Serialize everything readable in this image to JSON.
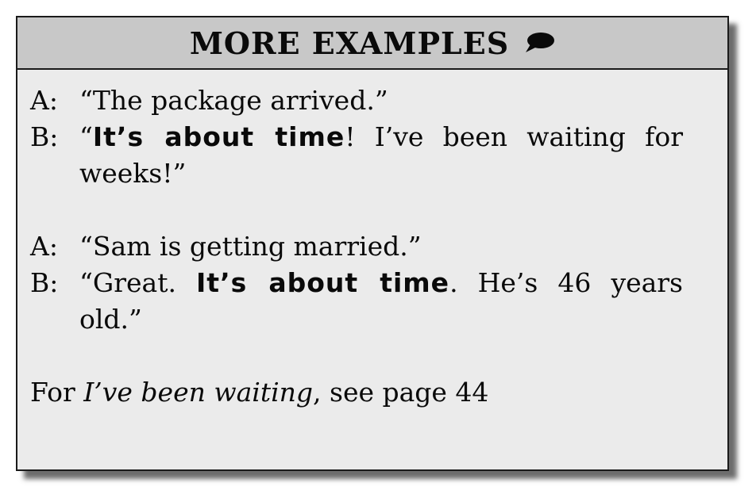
{
  "header": {
    "title": "MORE EXAMPLES"
  },
  "examples": [
    {
      "a_speaker": "A:",
      "a_text": "“The package arrived.”",
      "b_speaker": "B:",
      "b_pre": "“",
      "b_bold": "It’s about time",
      "b_post": "! I’ve been waiting for weeks!”"
    },
    {
      "a_speaker": "A:",
      "a_text": "“Sam is getting married.”",
      "b_speaker": "B:",
      "b_pre": "“Great. ",
      "b_bold": "It’s about time",
      "b_post": ". He’s 46 years old.”"
    }
  ],
  "footer": {
    "prefix": "For ",
    "italic": "I’ve been waiting",
    "suffix": ", see page 44"
  },
  "icons": {
    "header_icon": "speech-bubble-icon"
  }
}
